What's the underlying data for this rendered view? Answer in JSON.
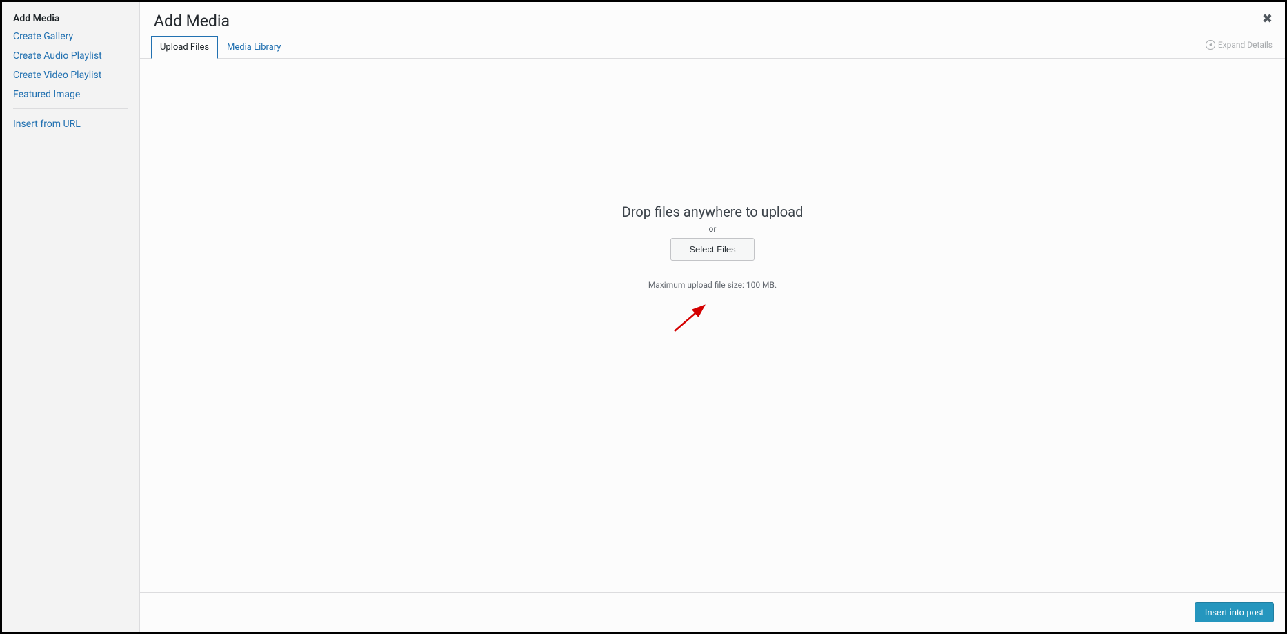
{
  "sidebar": {
    "title": "Add Media",
    "items": [
      "Create Gallery",
      "Create Audio Playlist",
      "Create Video Playlist",
      "Featured Image"
    ],
    "insert_url": "Insert from URL"
  },
  "header": {
    "title": "Add Media"
  },
  "tabs": {
    "upload": "Upload Files",
    "library": "Media Library"
  },
  "expand": "Expand Details",
  "content": {
    "drop": "Drop files anywhere to upload",
    "or": "or",
    "select": "Select Files",
    "max": "Maximum upload file size: 100 MB."
  },
  "footer": {
    "insert": "Insert into post"
  }
}
